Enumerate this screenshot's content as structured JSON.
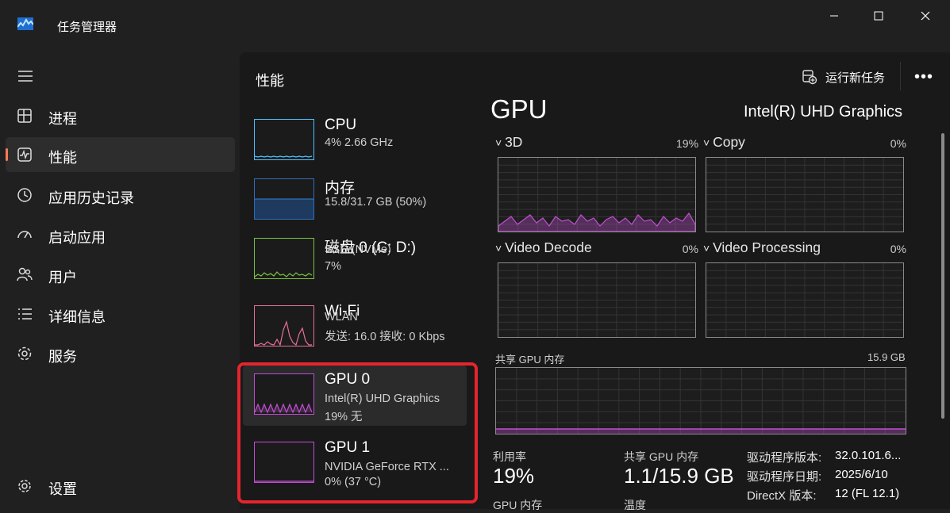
{
  "window": {
    "title": "任务管理器",
    "controls": [
      "minimize",
      "maximize",
      "close"
    ]
  },
  "sidebar": {
    "items": [
      {
        "label": "进程",
        "icon": "processes-icon"
      },
      {
        "label": "性能",
        "icon": "performance-icon",
        "active": true
      },
      {
        "label": "应用历史记录",
        "icon": "history-icon"
      },
      {
        "label": "启动应用",
        "icon": "startup-icon"
      },
      {
        "label": "用户",
        "icon": "users-icon"
      },
      {
        "label": "详细信息",
        "icon": "details-icon"
      },
      {
        "label": "服务",
        "icon": "services-icon"
      }
    ],
    "settings_label": "设置"
  },
  "header": {
    "title": "性能",
    "run_task_label": "运行新任务",
    "more_label": "•••"
  },
  "devices": [
    {
      "name": "CPU",
      "line1": "4% 2.66 GHz",
      "line2": "",
      "color": "#4cc2ff"
    },
    {
      "name": "内存",
      "line1": "15.8/31.7 GB (50%)",
      "line2": "",
      "color": "#2f6fb8"
    },
    {
      "name": "磁盘 0 (C: D:)",
      "line1": "SSD (NVMe)",
      "line2": "7%",
      "color": "#7cc242"
    },
    {
      "name": "Wi-Fi",
      "line1": "WLAN",
      "line2": "发送: 16.0 接收: 0 Kbps",
      "color": "#e5709b"
    },
    {
      "name": "GPU 0",
      "line1": "Intel(R) UHD Graphics",
      "line2": "19% 无",
      "color": "#c04fd1",
      "selected": true
    },
    {
      "name": "GPU 1",
      "line1": "NVIDIA GeForce RTX ...",
      "line2": "0% (37 °C)",
      "color": "#c04fd1"
    }
  ],
  "gpu": {
    "title": "GPU",
    "model": "Intel(R) UHD Graphics",
    "engines": [
      {
        "label": "3D",
        "pct": "19%"
      },
      {
        "label": "Copy",
        "pct": "0%"
      },
      {
        "label": "Video Decode",
        "pct": "0%"
      },
      {
        "label": "Video Processing",
        "pct": "0%"
      }
    ],
    "shared_memory": {
      "label": "共享 GPU 内存",
      "max": "15.9 GB"
    },
    "stats": {
      "utilization_label": "利用率",
      "utilization_value": "19%",
      "shared_mem_label": "共享 GPU 内存",
      "shared_mem_value": "1.1/15.9 GB",
      "gpu_mem_label": "GPU 内存",
      "temp_label": "温度"
    },
    "driver_info": [
      {
        "key": "驱动程序版本:",
        "value": "32.0.101.6..."
      },
      {
        "key": "驱动程序日期:",
        "value": "2025/6/10"
      },
      {
        "key": "DirectX 版本:",
        "value": "12 (FL 12.1)"
      }
    ]
  },
  "colors": {
    "accent": "#ff7a59",
    "gpu_graph": "#c04fd1",
    "highlight": "#e6242d"
  }
}
